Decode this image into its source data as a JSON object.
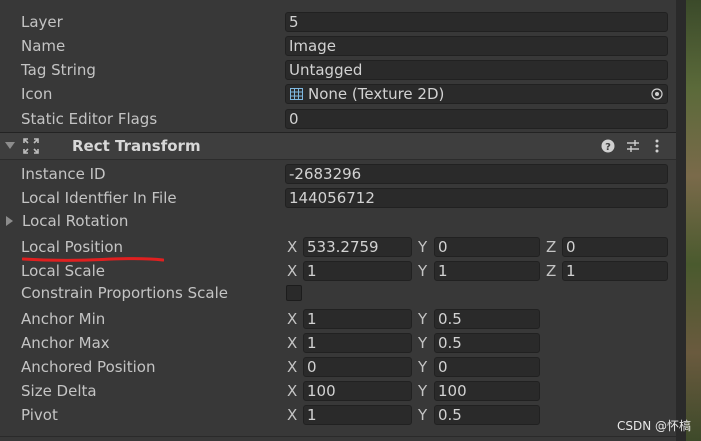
{
  "top_rows": [
    {
      "label": "Layer",
      "value": "5"
    },
    {
      "label": "Name",
      "value": "Image"
    },
    {
      "label": "Tag String",
      "value": "Untagged"
    },
    {
      "label": "Icon",
      "value": "None (Texture 2D)"
    },
    {
      "label": "Static Editor Flags",
      "value": "0"
    }
  ],
  "component": {
    "title": "Rect Transform",
    "icons": [
      "collapse-arrow-icon",
      "rect-transform-icon",
      "help-icon",
      "preset-icon",
      "more-icon"
    ]
  },
  "instance_id": {
    "label": "Instance ID",
    "value": "-2683296"
  },
  "local_identifier": {
    "label": "Local Identfier In File",
    "value": "144056712"
  },
  "local_rotation": {
    "label": "Local Rotation"
  },
  "local_position": {
    "label": "Local Position",
    "x_label": "X",
    "x": "533.2759",
    "y_label": "Y",
    "y": "0",
    "z_label": "Z",
    "z": "0"
  },
  "local_scale": {
    "label": "Local Scale",
    "x_label": "X",
    "x": "1",
    "y_label": "Y",
    "y": "1",
    "z_label": "Z",
    "z": "1"
  },
  "constrain": {
    "label": "Constrain Proportions Scale",
    "checked": false
  },
  "vec2_rows": [
    {
      "label": "Anchor Min",
      "x_label": "X",
      "x": "1",
      "y_label": "Y",
      "y": "0.5"
    },
    {
      "label": "Anchor Max",
      "x_label": "X",
      "x": "1",
      "y_label": "Y",
      "y": "0.5"
    },
    {
      "label": "Anchored Position",
      "x_label": "X",
      "x": "0",
      "y_label": "Y",
      "y": "0"
    },
    {
      "label": "Size Delta",
      "x_label": "X",
      "x": "100",
      "y_label": "Y",
      "y": "100"
    },
    {
      "label": "Pivot",
      "x_label": "X",
      "x": "1",
      "y_label": "Y",
      "y": "0.5"
    }
  ],
  "watermark": "CSDN @怀槁",
  "colors": {
    "background": "#383838",
    "field": "#2a2a2a",
    "annotation": "#e02020"
  }
}
